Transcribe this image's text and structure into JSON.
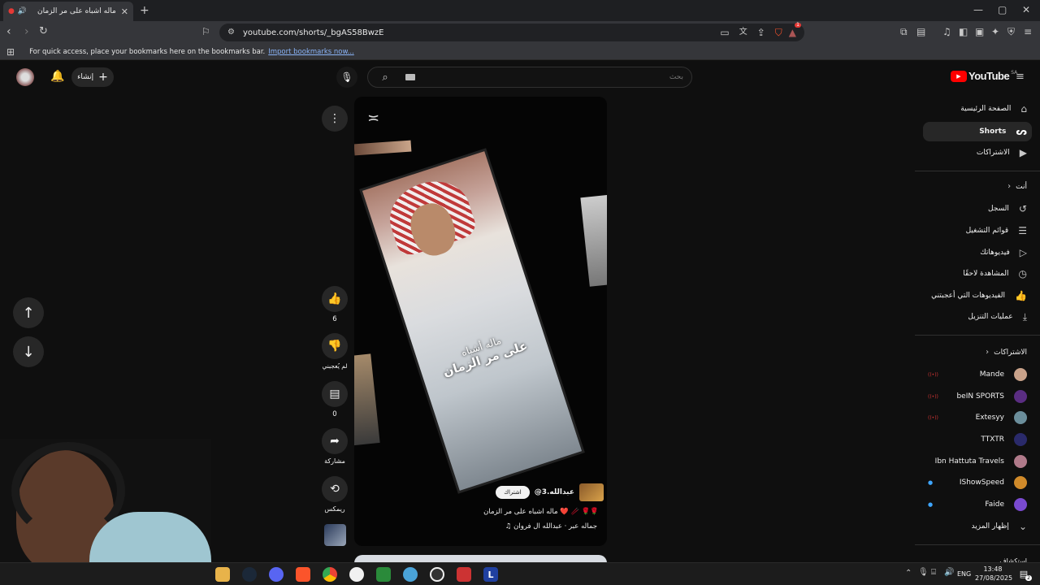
{
  "browser": {
    "tab_title": "ماله اشباه على مر الزمان",
    "url": "youtube.com/shorts/_bgAS58BwzE",
    "bookmarks_hint": "For quick access, place your bookmarks here on the bookmarks bar.",
    "bookmarks_import": "Import bookmarks now...",
    "badge_count": "1"
  },
  "header": {
    "create_label": "إنشاء",
    "search_placeholder": "بحث",
    "logo_text": "YouTube",
    "logo_region": "SA"
  },
  "sidebar": {
    "main": [
      {
        "label": "الصفحة الرئيسية",
        "icon": "home-icon"
      },
      {
        "label": "Shorts",
        "icon": "shorts-icon"
      },
      {
        "label": "الاشتراكات",
        "icon": "subscriptions-icon"
      }
    ],
    "you_title": "أنت",
    "you": [
      {
        "label": "السجل",
        "icon": "history-icon"
      },
      {
        "label": "قوائم التشغيل",
        "icon": "playlists-icon"
      },
      {
        "label": "فيديوهاتك",
        "icon": "your-videos-icon"
      },
      {
        "label": "المشاهدة لاحقًا",
        "icon": "watch-later-icon"
      },
      {
        "label": "الفيديوهات التي أعجبتني",
        "icon": "liked-icon"
      },
      {
        "label": "عمليات التنزيل",
        "icon": "download-icon"
      }
    ],
    "subs_title": "الاشتراكات",
    "subscriptions": [
      {
        "label": "Mande",
        "color": "#c9a28a"
      },
      {
        "label": "beIN SPORTS",
        "color": "#5a2d82"
      },
      {
        "label": "Extesyy",
        "color": "#6b8e9b"
      },
      {
        "label": "TTXTR",
        "color": "#2a2a6a"
      },
      {
        "label": "Ibn Hattuta Travels",
        "color": "#b07a8a"
      },
      {
        "label": "IShowSpeed",
        "color": "#d08a2a"
      },
      {
        "label": "Faide",
        "color": "#7a4ad0"
      }
    ],
    "show_more": "إظهار المزيد",
    "explore": "استكشاف"
  },
  "short": {
    "overlay_line1": "ماله أشباه",
    "overlay_line2": "على مر الزمان",
    "channel": "@عبدالله.3",
    "subscribe": "اشتراك",
    "title": "ماله اشباه على مر الزمان ❤️ 🥢 🌹🌹",
    "sound": "♫ جماله عبر · عبدالله ال فروان"
  },
  "actions": {
    "likes": "6",
    "dislike": "لم يُعجبني",
    "comments": "0",
    "share": "مشاركة",
    "remix": "ريمكس"
  },
  "taskbar": {
    "lang": "ENG",
    "time": "13:48",
    "date": "27/08/2025",
    "notifications": "2"
  },
  "colors": {
    "accent_red": "#ff0000",
    "link_blue": "#8ab4f8"
  }
}
